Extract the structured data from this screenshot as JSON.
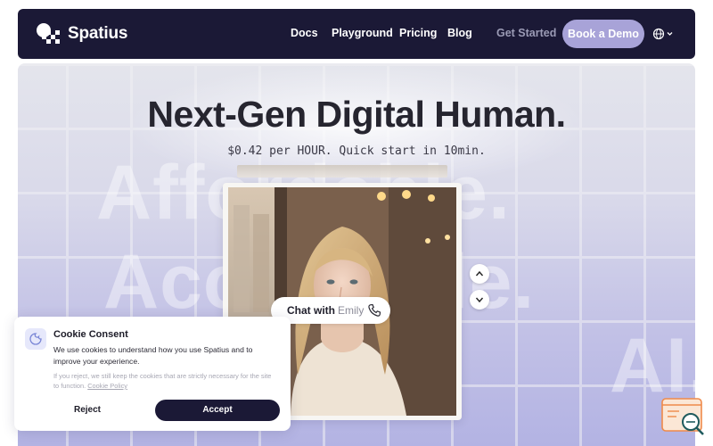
{
  "nav": {
    "brand": "Spatius",
    "links": [
      "Docs",
      "Playground",
      "Pricing",
      "Blog"
    ],
    "get_started": "Get Started",
    "demo_button": "Book a Demo",
    "language_icon": "globe-icon",
    "language_chevron": "chevron-down-icon"
  },
  "hero": {
    "title": "Next-Gen Digital Human.",
    "subtitle": "$0.42 per HOUR. Quick start in 10min.",
    "background_words": [
      "Affordable.",
      "Accessible.",
      "AI."
    ]
  },
  "video_card": {
    "chat_label": "Chat with",
    "chat_name": "Emily",
    "call_icon": "phone-icon",
    "scroll_up_icon": "chevron-up-icon",
    "scroll_down_icon": "chevron-down-icon"
  },
  "cookie": {
    "title": "Cookie Consent",
    "body": "We use cookies to understand how you use Spatius and to improve your experience.",
    "note": "If you reject, we still keep the cookies that are strictly necessary for the site to function.",
    "policy_link": "Cookie Policy",
    "reject": "Reject",
    "accept": "Accept",
    "icon": "cookie-icon"
  },
  "colors": {
    "nav_bg": "#1b1936",
    "accent": "#a8a3d8",
    "hero_bg_top": "#e4e5ec",
    "hero_bg_bottom": "#b3b3e3"
  }
}
